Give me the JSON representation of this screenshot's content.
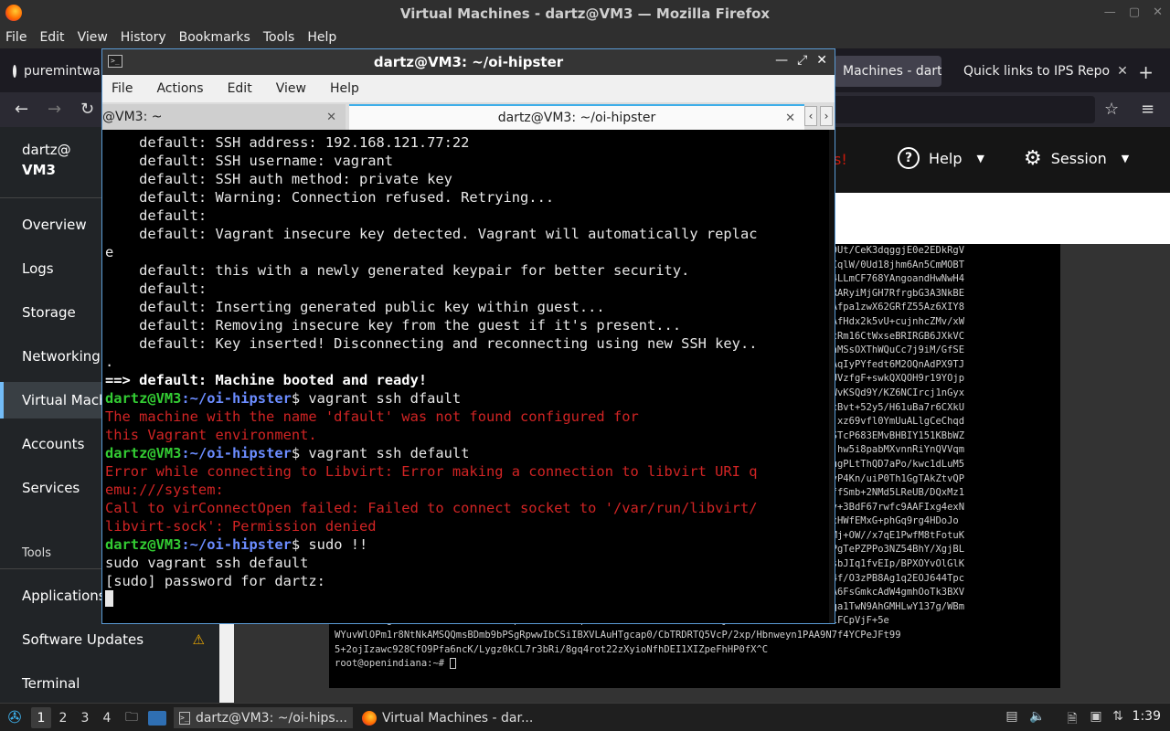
{
  "firefox": {
    "window_title": "Virtual Machines - dartz@VM3 — Mozilla Firefox",
    "menu": [
      "File",
      "Edit",
      "View",
      "History",
      "Bookmarks",
      "Tools",
      "Help"
    ],
    "tabs": [
      {
        "label": "puremintwa"
      },
      {
        "label": "Machines - dart"
      },
      {
        "label": "Quick links to IPS Repo"
      }
    ]
  },
  "cockpit": {
    "host_user": "dartz@",
    "host_name": "VM3",
    "nav": [
      "Overview",
      "Logs",
      "Storage",
      "Networking",
      "Virtual Mach",
      "Accounts",
      "Services"
    ],
    "tools_header": "Tools",
    "tools": [
      "Applications",
      "Software Updates",
      "Terminal"
    ],
    "header": {
      "warning_text": "s!",
      "help_label": "Help",
      "session_label": "Session"
    },
    "vm_console": {
      "lines": [
        "...............................................................................AFKjj/R0Ut/CeK3dqggjE0e2EDkRgV",
        "...............................................................................bMH7gIVCqlW/0Ud18jhm6An5CmMOBT",
        "...............................................................................Rjfv3954LLmCF768YAngoandHwNwH4",
        "...............................................................................R/8F8aSRARyiMjGH7RfrgbG3A3NkBE",
        "...............................................................................R2AZ5+cAfpa1zwX62GRfZ55Az6XIY8",
        "...............................................................................eovKA8gAfHdx2k5vU+cujnhcZMv/xW",
        "...............................................................................4ZBAEadcRm16CtWxseBRIRGB6JXkVC",
        "...............................................................................It8IuAvhMSsOXThWQuCc7j9iM/GfSE",
        "...............................................................................bftA9BYAqIyPYfedt6M2OQnAdPX9TJ",
        "...............................................................................LwMIb27UVzfgF+swkQXQOH9r19YOjp",
        "...............................................................................UPituZ2WvKSQd9Y/KZ6NCIrcj1nGyx",
        "...............................................................................DNKA8OxcBvt+52y5/H61uBa7r6CXkU",
        "...............................................................................gvjgvUMjxz69vfl0YmUuALlgCeChqd",
        "...............................................................................xbjWfOASTcP683EMvBHBIY151KBbWZ",
        "...............................................................................QBeXHQcjhw5i8pabMXvnnRiYnQVVqm",
        "...............................................................................sAPvD22ugPLtThQD7aPo/kwc1dLuM5",
        "...............................................................................4KA1zokvP4Kn/uiP0Th1GgTAkZtvQP",
        "...............................................................................x/DvY/effSmb+2NMd5LReUB/DQxMz1",
        "...............................................................................XwKnUoHv+3BdF67rwfc9AAFIxg4exN",
        "...............................................................................AQn0CICcHWfEMxG+phGq9rg4HDoJo",
        "...............................................................................b80bAKiMj+OW//x7qE1PwfM8tFotuK",
        "...............................................................................nwN9ax/PgTePZPPo3NZ54BhY/XgjBL",
        "...............................................................................C8IDuH9sbJIq1fvEIp/BPXOYvOlGlK",
        "...............................................................................Lq+uvxg4f/O3zPB8Ag1q2EOJ644Tpc",
        "...............................................................................eQN55gWA6FsGmkcAdW4gmhOoTk3BXV",
        "...............................................................................fH6hcAfqa1TwN9AhGMHLwY137g/WBm",
        "NZFDHmz8ugIrDdTo7RIkJKIbxfewvH1pe99x45Tom1q4bK8VnHXHnAmdbwzkdvwbBaKjbWN7Hd2Mb29ha2t5twiFCpVjF+5e",
        "WYuvWlOPm1r8NtNkAMSQQmsBDmb9bPSgRpwwIbCSiIBXVLAuHTgcap0/CbTRDRTQ5VcP/2xp/Hbnweyn1PAA9N7f4YCPeJFt99",
        "5+2ojIzawc928CfO9Pfa6ncK/Lygz0kCL7r3bRi/8gq4rot22zXyioNfhDEI1XIZpeFhHP0fX^C"
      ],
      "prompt": "root@openindiana:~# "
    }
  },
  "terminal": {
    "window_title": "dartz@VM3: ~/oi-hipster",
    "menu": [
      "File",
      "Actions",
      "Edit",
      "View",
      "Help"
    ],
    "tabs": [
      {
        "label": "@VM3: ~"
      },
      {
        "label": "dartz@VM3: ~/oi-hipster"
      }
    ],
    "prompt_user": "dartz@VM3",
    "prompt_path": ":~/oi-hipster",
    "lines": {
      "l1": "    default: SSH address: 192.168.121.77:22",
      "l2": "    default: SSH username: vagrant",
      "l3": "    default: SSH auth method: private key",
      "l4": "    default: Warning: Connection refused. Retrying...",
      "l5": "    default:",
      "l6": "    default: Vagrant insecure key detected. Vagrant will automatically replac",
      "l7": "e",
      "l8": "    default: this with a newly generated keypair for better security.",
      "l9": "    default:",
      "l10": "    default: Inserting generated public key within guest...",
      "l11": "    default: Removing insecure key from the guest if it's present...",
      "l12": "    default: Key inserted! Disconnecting and reconnecting using new SSH key..",
      "l13": ".",
      "l14": "==> default: Machine booted and ready!",
      "cmd1": "$ vagrant ssh dfault",
      "err1a": "The machine with the name 'dfault' was not found configured for",
      "err1b": "this Vagrant environment.",
      "cmd2": "$ vagrant ssh default",
      "err2a": "Error while connecting to Libvirt: Error making a connection to libvirt URI q",
      "err2b": "emu:///system:",
      "err2c": "Call to virConnectOpen failed: Failed to connect socket to '/var/run/libvirt/",
      "err2d": "libvirt-sock': Permission denied",
      "cmd3": "$ sudo !!",
      "echo3": "sudo vagrant ssh default",
      "sudo_prompt": "[sudo] password for dartz:"
    }
  },
  "taskbar": {
    "workspaces": [
      "1",
      "2",
      "3",
      "4"
    ],
    "windows": [
      {
        "label": "dartz@VM3: ~/oi-hips..."
      },
      {
        "label": "Virtual Machines - dar..."
      }
    ],
    "clock": "1:39"
  }
}
